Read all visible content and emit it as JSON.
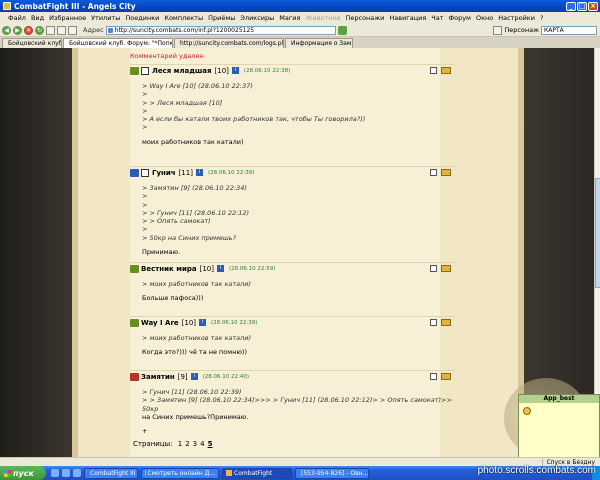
{
  "window": {
    "title": "CombatFight III - Angels City"
  },
  "menu": [
    "Файл",
    "Вид",
    "Избранное",
    "Утилиты",
    "Поединки",
    "Комплекты",
    "Приёмы",
    "Эликсиры",
    "Магия",
    "Животное",
    "Персонажи",
    "Навигация",
    "Чат",
    "Форум",
    "Окно",
    "Настройки",
    "?"
  ],
  "menu_disabled_index": 9,
  "toolbar": {
    "address_label": "Адрес",
    "address_value": "http://suncity.combats.com/inf.pl?1200025125",
    "search_label": "Персонаж",
    "search_value": "КАРТА"
  },
  "tabs": [
    {
      "label": "Бойцовский клуб",
      "active": false
    },
    {
      "label": "Бойцовский клуб. Форум: \"*Попкор...",
      "active": true
    },
    {
      "label": "http://suncity.combats.com/logs.pl?lo...",
      "active": false
    },
    {
      "label": "Информация о Замятин",
      "active": false
    }
  ],
  "removed_note": "Комментарий удален",
  "posts": [
    {
      "nick": "Леся младшая",
      "level": "[10]",
      "time": "(28.06.10 22:38)",
      "cls_color": "#6b8e23",
      "clan_icon": "globe-icon",
      "lines": [
        "> Way I Are [10] (28.06.10 22:37)",
        ">",
        "> > Леся младшая [10]",
        ">",
        "> А если бы катали твоих работников так, чтобы Ты говорила?))",
        ">",
        "",
        "моих работников так катали)"
      ]
    },
    {
      "nick": "Гунич",
      "level": "[11]",
      "time": "(28.06.10 22:39)",
      "cls_color": "#2b5cb8",
      "clan_icon": "clan-badge-icon",
      "lines": [
        "> Замятин [9] (28.06.10 22:34)",
        ">",
        ">",
        "> > Гунич [11] (28.06.10 22:12)",
        "> > Опять самокат)",
        ">",
        "> 50кр на Синих примешь?",
        "",
        "Принимаю."
      ]
    },
    {
      "nick": "Вестник мира",
      "level": "[10]",
      "time": "(28.06.10 22:59)",
      "cls_color": "#6b8e23",
      "clan_icon": "",
      "lines": [
        "> моих работников так катали)",
        "",
        "Больше пафоса)))"
      ]
    },
    {
      "nick": "Way I Are",
      "level": "[10]",
      "time": "(28.06.10 22:39)",
      "cls_color": "#6b8e23",
      "clan_icon": "",
      "lines": [
        "> моих работников так катали)",
        "",
        "Когда это?))) чё та не помню))"
      ]
    },
    {
      "nick": "Замятин",
      "level": "[9]",
      "time": "(28.06.10 22:40)",
      "cls_color": "#b8342b",
      "clan_icon": "",
      "lines": [
        ">  Гунич [11] (28.06.10 22:39)",
        "> > Замятин [9] (28.06.10 22:34)>>> > Гунич [11] (28.06.10 22:12)> > Опять самокат)>> 50кр",
        "на Синих примешь?Принимаю.",
        "",
        "+"
      ]
    }
  ],
  "pager": {
    "label": "Страницы:",
    "pages": [
      "1",
      "2",
      "3",
      "4",
      "5"
    ],
    "current": "5"
  },
  "widget": {
    "title": "App_best"
  },
  "status": {
    "left": "",
    "right": "Спуск в Бездну"
  },
  "taskbar": {
    "start": "пуск",
    "buttons": [
      {
        "label": "CombatFight III",
        "active": false
      },
      {
        "label": "Смотреть онлайн Д...",
        "active": false
      },
      {
        "label": "CombatFight",
        "active": true
      },
      {
        "label": "[553-954-826] - Овн...",
        "active": false
      }
    ]
  },
  "watermark": "photo.scrolls.combats.com"
}
